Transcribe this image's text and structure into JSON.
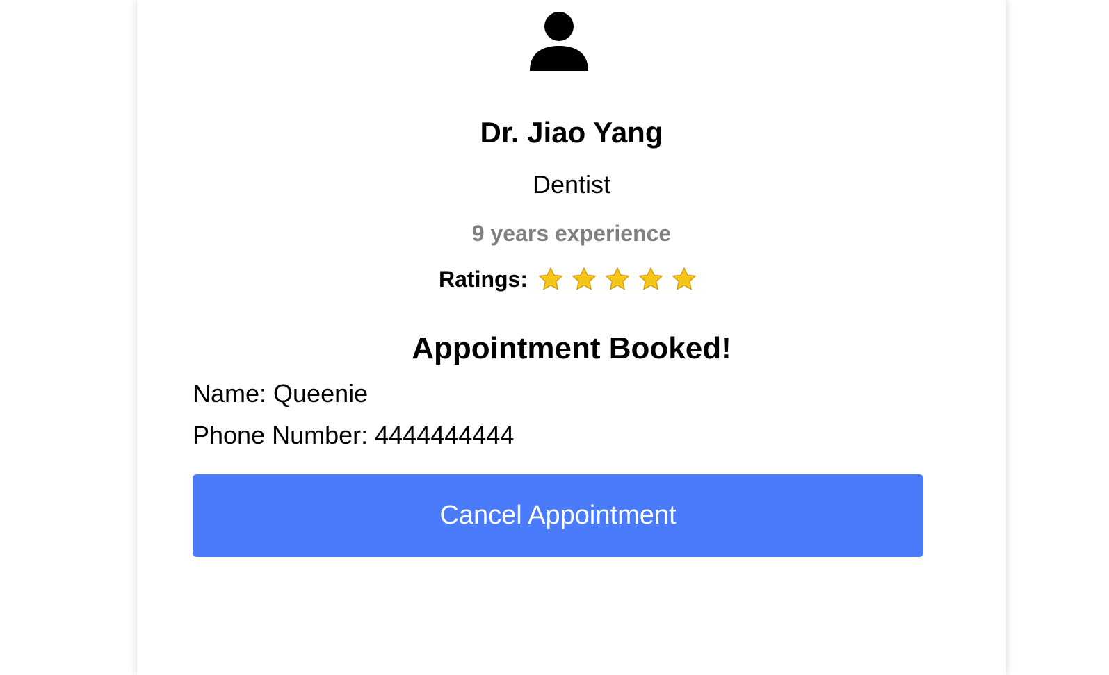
{
  "doctor": {
    "avatar_icon": "user-silhouette-icon",
    "name": "Dr. Jiao Yang",
    "specialty": "Dentist",
    "experience": "9 years experience",
    "ratings_label": "Ratings:",
    "rating": 5,
    "rating_max": 5,
    "star_icon": "star-icon",
    "star_color": "#F5C518"
  },
  "booking": {
    "title": "Appointment Booked!",
    "name_line": "Name: Queenie",
    "phone_line": "Phone Number: 4444444444",
    "cancel_label": "Cancel Appointment",
    "cancel_color": "#4A7BFB"
  }
}
